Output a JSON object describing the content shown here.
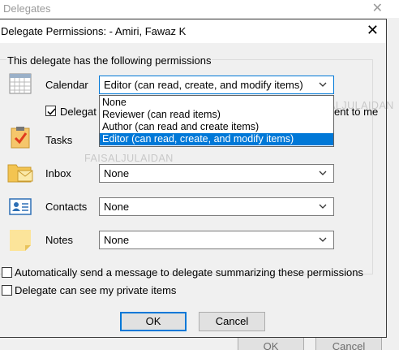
{
  "background_window": {
    "title": "Delegates",
    "ok_label": "OK",
    "cancel_label": "Cancel"
  },
  "dialog": {
    "title": "Delegate Permissions: - Amiri, Fawaz K",
    "group_caption": "This delegate has the following permissions",
    "rows": [
      {
        "label": "Calendar",
        "value": "Editor (can read, create, and modify items)",
        "icon": "calendar-icon"
      },
      {
        "label": "Tasks",
        "value": "",
        "icon": "tasks-icon"
      },
      {
        "label": "Inbox",
        "value": "None",
        "icon": "inbox-icon"
      },
      {
        "label": "Contacts",
        "value": "None",
        "icon": "contacts-icon"
      },
      {
        "label": "Notes",
        "value": "None",
        "icon": "notes-icon"
      }
    ],
    "calendar_checkbox": {
      "label_left": "Delegat",
      "label_right": "ent to me",
      "checked": true
    },
    "dropdown_options": [
      "None",
      "Reviewer (can read items)",
      "Author (can read and create items)",
      "Editor (can read, create, and modify items)"
    ],
    "selected_option_index": 3,
    "auto_send_label": "Automatically send a message to delegate summarizing these permissions",
    "private_items_label": "Delegate can see my private items",
    "ok_label": "OK",
    "cancel_label": "Cancel"
  },
  "watermarks": [
    "FAISALJULAIDAN",
    "FAISALJULAIDAN"
  ],
  "colors": {
    "accent": "#0078d7",
    "dialog_bg": "#f0f0f0"
  }
}
